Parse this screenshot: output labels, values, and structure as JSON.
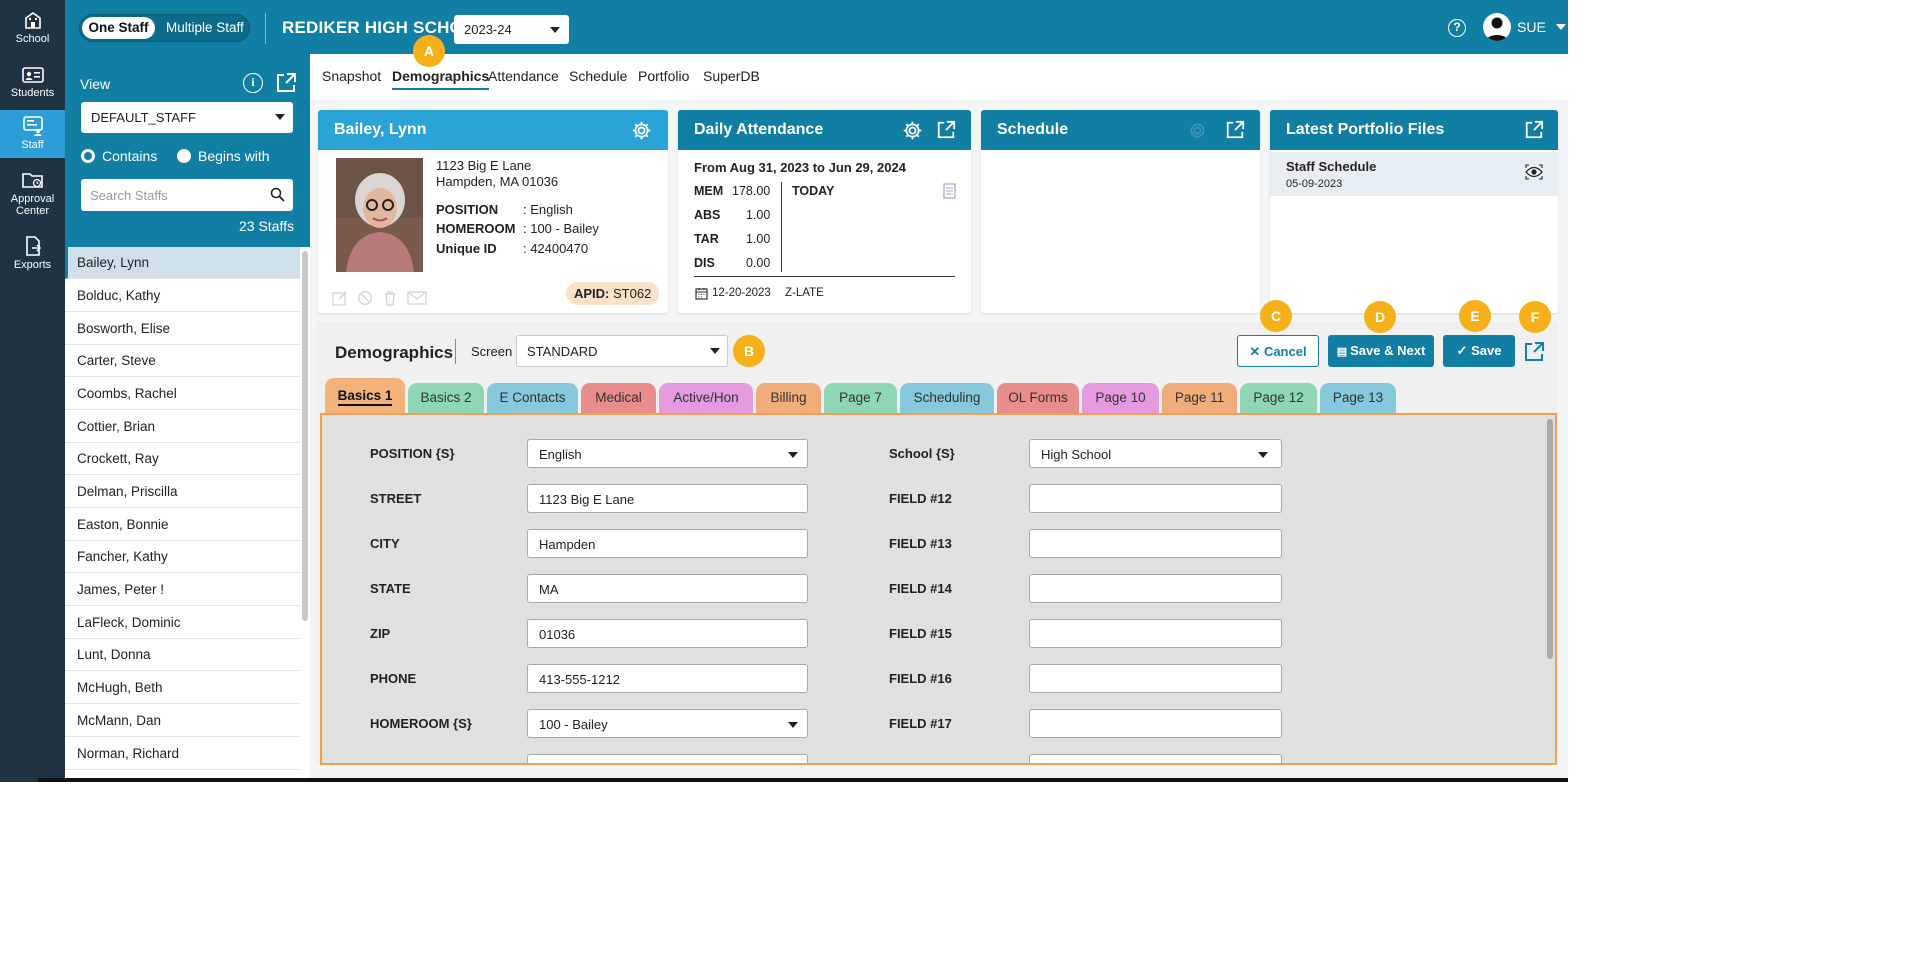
{
  "sidenav": [
    {
      "label": "School",
      "icon": "school-icon"
    },
    {
      "label": "Students",
      "icon": "students-icon"
    },
    {
      "label": "Staff",
      "icon": "staff-icon"
    },
    {
      "label": "Approval Center",
      "icon": "folder-clock-icon"
    },
    {
      "label": "Exports",
      "icon": "export-file-icon"
    }
  ],
  "header": {
    "toggle_one": "One Staff",
    "toggle_multi": "Multiple Staff",
    "school": "REDIKER HIGH SCHOOL",
    "year": "2023-24",
    "user": "SUE",
    "help": "?"
  },
  "panel": {
    "view_label": "View",
    "view_value": "DEFAULT_STAFF",
    "radio_contains": "Contains",
    "radio_begins": "Begins with",
    "search_placeholder": "Search Staffs",
    "count": "23 Staffs",
    "staff": [
      "Bailey, Lynn",
      "Bolduc, Kathy",
      "Bosworth, Elise",
      "Carter, Steve",
      "Coombs, Rachel",
      "Cottier, Brian",
      "Crockett, Ray",
      "Delman, Priscilla",
      "Easton, Bonnie",
      "Fancher, Kathy",
      "James, Peter !",
      "LaFleck, Dominic",
      "Lunt, Donna",
      "McHugh, Beth",
      "McMann, Dan",
      "Norman, Richard"
    ]
  },
  "subnav": [
    "Snapshot",
    "Demographics",
    "Attendance",
    "Schedule",
    "Portfolio",
    "SuperDB"
  ],
  "badges": [
    "A",
    "B",
    "C",
    "D",
    "E",
    "F"
  ],
  "profile": {
    "name": "Bailey, Lynn",
    "address1": "1123 Big E Lane",
    "address2": "Hampden, MA 01036",
    "position_label": "POSITION",
    "position": ": English",
    "homeroom_label": "HOMEROOM",
    "homeroom": ": 100 - Bailey",
    "uid_label": "Unique ID",
    "uid": ": 42400470",
    "apid_label": "APID:",
    "apid": "ST062"
  },
  "attendance": {
    "title": "Daily Attendance",
    "range": "From Aug 31, 2023 to Jun 29, 2024",
    "rows": [
      {
        "label": "MEM",
        "value": "178.00"
      },
      {
        "label": "ABS",
        "value": "1.00"
      },
      {
        "label": "TAR",
        "value": "1.00"
      },
      {
        "label": "DIS",
        "value": "0.00"
      }
    ],
    "today": "TODAY",
    "date": "12-20-2023",
    "code": "Z-LATE"
  },
  "schedule": {
    "title": "Schedule"
  },
  "portfolio": {
    "title": "Latest Portfolio Files",
    "file": "Staff Schedule",
    "file_date": "05-09-2023"
  },
  "demographics": {
    "title": "Demographics",
    "screen_label": "Screen",
    "screen_value": "STANDARD",
    "cancel": "Cancel",
    "save_next": "Save & Next",
    "save": "Save"
  },
  "tabs": [
    {
      "label": "Basics 1",
      "color": "#f3b27b"
    },
    {
      "label": "Basics 2",
      "color": "#8fd6b4"
    },
    {
      "label": "E Contacts",
      "color": "#86c8dc"
    },
    {
      "label": "Medical",
      "color": "#e98c8c"
    },
    {
      "label": "Active/Hon",
      "color": "#e59ae0"
    },
    {
      "label": "Billing",
      "color": "#f1ad79"
    },
    {
      "label": "Page 7",
      "color": "#8fd6b4"
    },
    {
      "label": "Scheduling",
      "color": "#86c8dc"
    },
    {
      "label": "OL Forms",
      "color": "#e98c8c"
    },
    {
      "label": "Page 10",
      "color": "#e59ae0"
    },
    {
      "label": "Page 11",
      "color": "#f1ad79"
    },
    {
      "label": "Page 12",
      "color": "#8fd6b4"
    },
    {
      "label": "Page 13",
      "color": "#86c8dc"
    }
  ],
  "form_left": [
    {
      "label": "POSITION {S}",
      "value": "English",
      "dropdown": true
    },
    {
      "label": "STREET",
      "value": "1123 Big E Lane"
    },
    {
      "label": "CITY",
      "value": "Hampden"
    },
    {
      "label": "STATE",
      "value": "MA"
    },
    {
      "label": "ZIP",
      "value": "01036"
    },
    {
      "label": "PHONE",
      "value": "413-555-1212"
    },
    {
      "label": "HOMEROOM {S}",
      "value": "100 - Bailey",
      "dropdown": true
    }
  ],
  "form_right": [
    {
      "label": "School {S}",
      "value": "High School",
      "dropdown": true
    },
    {
      "label": "FIELD #12",
      "value": ""
    },
    {
      "label": "FIELD #13",
      "value": ""
    },
    {
      "label": "FIELD #14",
      "value": ""
    },
    {
      "label": "FIELD #15",
      "value": ""
    },
    {
      "label": "FIELD #16",
      "value": ""
    },
    {
      "label": "FIELD #17",
      "value": ""
    }
  ],
  "colors": {
    "primary": "#117ea3",
    "accent": "#2aa3d6",
    "nav": "#1f3342",
    "badge": "#f6b01a"
  }
}
